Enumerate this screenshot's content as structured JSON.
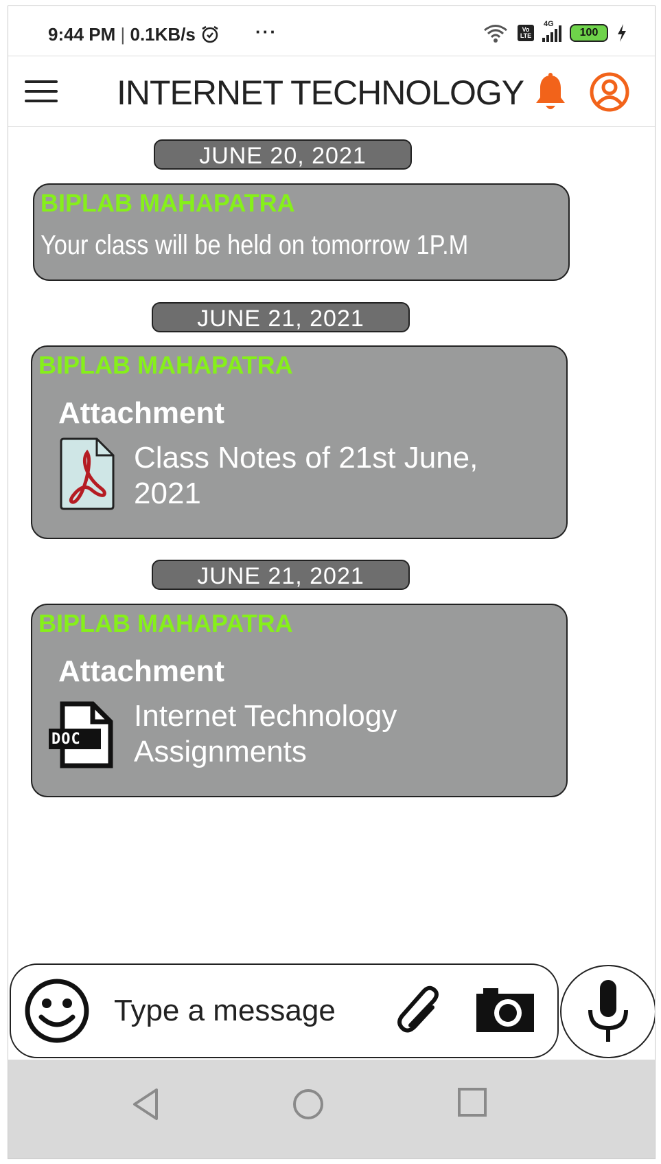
{
  "status_bar": {
    "time": "9:44 PM",
    "separator": "|",
    "speed": "0.1KB/s",
    "more": "···",
    "lte_label": "Vo LTE",
    "network": "4G",
    "battery": "100"
  },
  "app_bar": {
    "title": "INTERNET TECHNOLOGY",
    "menu_icon": "hamburger-menu-icon",
    "notification_icon": "bell-icon",
    "profile_icon": "user-avatar-icon",
    "accent_color": "#f2631a"
  },
  "messages": [
    {
      "date": "JUNE 20, 2021",
      "sender": "BIPLAB MAHAPATRA",
      "text": "Your class will be held on tomorrow 1P.M"
    },
    {
      "date": "JUNE 21, 2021",
      "sender": "BIPLAB MAHAPATRA",
      "attachment_heading": "Attachment",
      "attachment_name": "Class Notes of 21st June, 2021",
      "attachment_icon": "pdf-file-icon"
    },
    {
      "date": "JUNE 21, 2021",
      "sender": "BIPLAB MAHAPATRA",
      "attachment_heading": "Attachment",
      "attachment_name": "Internet Technology Assignments",
      "attachment_icon": "doc-file-icon",
      "doc_label": "DOC"
    }
  ],
  "composer": {
    "placeholder": "Type a message",
    "emoji_icon": "emoji-icon",
    "attach_icon": "paperclip-icon",
    "camera_icon": "camera-icon",
    "mic_icon": "microphone-icon"
  },
  "colors": {
    "bubble": "#9a9b9b",
    "date_pill": "#6e6e6e",
    "sender": "#86f01a",
    "nav_bar": "#d9d9d9"
  }
}
